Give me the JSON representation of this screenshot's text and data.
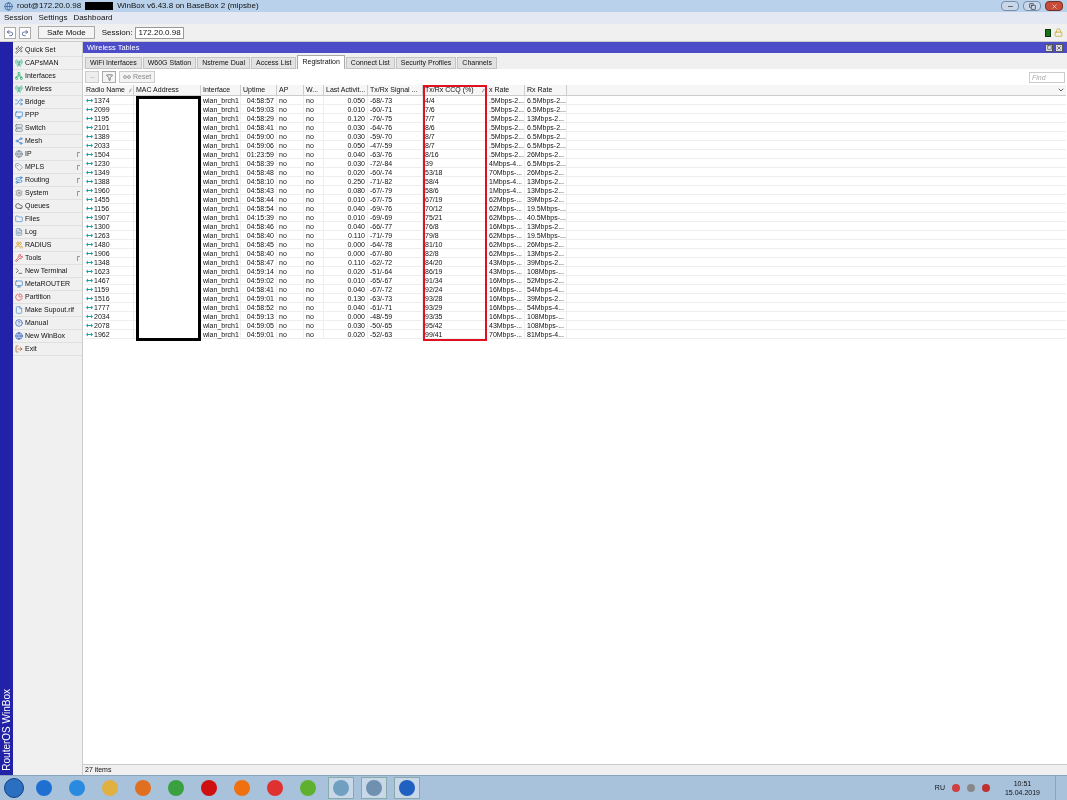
{
  "window": {
    "title_left": "root@172.20.0.98",
    "title_right": "WinBox v6.43.8 on BaseBox 2 (mipsbe)"
  },
  "menu": [
    "Session",
    "Settings",
    "Dashboard"
  ],
  "toolbar": {
    "safe_mode": "Safe Mode",
    "session_label": "Session:",
    "session_value": "172.20.0.98"
  },
  "sidebar": {
    "brand": "RouterOS WinBox",
    "items": [
      {
        "label": "Quick Set",
        "has_submenu": false
      },
      {
        "label": "CAPsMAN",
        "has_submenu": false
      },
      {
        "label": "Interfaces",
        "has_submenu": false
      },
      {
        "label": "Wireless",
        "has_submenu": false
      },
      {
        "label": "Bridge",
        "has_submenu": false
      },
      {
        "label": "PPP",
        "has_submenu": false
      },
      {
        "label": "Switch",
        "has_submenu": false
      },
      {
        "label": "Mesh",
        "has_submenu": false
      },
      {
        "label": "IP",
        "has_submenu": true
      },
      {
        "label": "MPLS",
        "has_submenu": true
      },
      {
        "label": "Routing",
        "has_submenu": true
      },
      {
        "label": "System",
        "has_submenu": true
      },
      {
        "label": "Queues",
        "has_submenu": false
      },
      {
        "label": "Files",
        "has_submenu": false
      },
      {
        "label": "Log",
        "has_submenu": false
      },
      {
        "label": "RADIUS",
        "has_submenu": false
      },
      {
        "label": "Tools",
        "has_submenu": true
      },
      {
        "label": "New Terminal",
        "has_submenu": false
      },
      {
        "label": "MetaROUTER",
        "has_submenu": false
      },
      {
        "label": "Partition",
        "has_submenu": false
      },
      {
        "label": "Make Supout.rif",
        "has_submenu": false
      },
      {
        "label": "Manual",
        "has_submenu": false
      },
      {
        "label": "New WinBox",
        "has_submenu": false
      },
      {
        "label": "Exit",
        "has_submenu": false
      }
    ]
  },
  "panel": {
    "title": "Wireless Tables",
    "tabs": [
      {
        "label": "WiFi Interfaces",
        "selected": false
      },
      {
        "label": "W60G Station",
        "selected": false
      },
      {
        "label": "Nstreme Dual",
        "selected": false
      },
      {
        "label": "Access List",
        "selected": false
      },
      {
        "label": "Registration",
        "selected": true
      },
      {
        "label": "Connect List",
        "selected": false
      },
      {
        "label": "Security Profiles",
        "selected": false
      },
      {
        "label": "Channels",
        "selected": false
      }
    ],
    "reset_label": "Reset",
    "find_placeholder": "Find",
    "columns": [
      {
        "label": "Radio Name",
        "sorted": true,
        "highlighted": false
      },
      {
        "label": "MAC Address",
        "sorted": false,
        "highlighted": false
      },
      {
        "label": "Interface",
        "sorted": false,
        "highlighted": false
      },
      {
        "label": "Uptime",
        "sorted": false,
        "highlighted": false
      },
      {
        "label": "AP",
        "sorted": false,
        "highlighted": false
      },
      {
        "label": "W...",
        "sorted": false,
        "highlighted": false
      },
      {
        "label": "Last Activit...",
        "sorted": false,
        "highlighted": false
      },
      {
        "label": "Tx/Rx Signal ...",
        "sorted": false,
        "highlighted": false
      },
      {
        "label": "Tx/Rx CCQ (%)",
        "sorted": true,
        "highlighted": true
      },
      {
        "label": "x Rate",
        "sorted": false,
        "highlighted": false
      },
      {
        "label": "Rx Rate",
        "sorted": false,
        "highlighted": false
      }
    ],
    "rows": [
      [
        "1374",
        "",
        "wlan_brch1",
        "04:58:57",
        "no",
        "no",
        "0.050",
        "-68/-73",
        "4/4",
        ".5Mbps-2...",
        "6.5Mbps-2..."
      ],
      [
        "2099",
        "",
        "wlan_brch1",
        "04:59:03",
        "no",
        "no",
        "0.010",
        "-60/-71",
        "7/6",
        ".5Mbps-2...",
        "6.5Mbps-2..."
      ],
      [
        "1195",
        "",
        "wlan_brch1",
        "04:58:29",
        "no",
        "no",
        "0.120",
        "-76/-75",
        "7/7",
        ".5Mbps-2...",
        "13Mbps-2..."
      ],
      [
        "2101",
        "",
        "wlan_brch1",
        "04:58:41",
        "no",
        "no",
        "0.030",
        "-64/-76",
        "8/6",
        ".5Mbps-2...",
        "6.5Mbps-2..."
      ],
      [
        "1389",
        "",
        "wlan_brch1",
        "04:59:00",
        "no",
        "no",
        "0.030",
        "-59/-70",
        "8/7",
        ".5Mbps-2...",
        "6.5Mbps-2..."
      ],
      [
        "2033",
        "",
        "wlan_brch1",
        "04:59:06",
        "no",
        "no",
        "0.050",
        "-47/-59",
        "8/7",
        ".5Mbps-2...",
        "6.5Mbps-2..."
      ],
      [
        "1504",
        "",
        "wlan_brch1",
        "01:23:59",
        "no",
        "no",
        "0.040",
        "-63/-76",
        "8/16",
        ".5Mbps-2...",
        "26Mbps-2..."
      ],
      [
        "1230",
        "",
        "wlan_brch1",
        "04:58:39",
        "no",
        "no",
        "0.030",
        "-72/-84",
        "39",
        "4Mbps-4...",
        "6.5Mbps-2..."
      ],
      [
        "1349",
        "",
        "wlan_brch1",
        "04:58:48",
        "no",
        "no",
        "0.020",
        "-60/-74",
        "53/18",
        "70Mbps-...",
        "26Mbps-2..."
      ],
      [
        "1388",
        "",
        "wlan_brch1",
        "04:58:10",
        "no",
        "no",
        "0.250",
        "-71/-82",
        "58/4",
        "1Mbps-4...",
        "13Mbps-2..."
      ],
      [
        "1960",
        "",
        "wlan_brch1",
        "04:58:43",
        "no",
        "no",
        "0.080",
        "-67/-79",
        "58/6",
        "1Mbps-4...",
        "13Mbps-2..."
      ],
      [
        "1455",
        "",
        "wlan_brch1",
        "04:58:44",
        "no",
        "no",
        "0.010",
        "-67/-75",
        "67/19",
        "62Mbps-...",
        "39Mbps-2..."
      ],
      [
        "1156",
        "",
        "wlan_brch1",
        "04:58:54",
        "no",
        "no",
        "0.040",
        "-69/-76",
        "70/12",
        "62Mbps-...",
        "19.5Mbps-..."
      ],
      [
        "1907",
        "",
        "wlan_brch1",
        "04:15:39",
        "no",
        "no",
        "0.010",
        "-69/-69",
        "75/21",
        "62Mbps-...",
        "40.5Mbps-..."
      ],
      [
        "1300",
        "",
        "wlan_brch1",
        "04:58:46",
        "no",
        "no",
        "0.040",
        "-66/-77",
        "76/8",
        "16Mbps-...",
        "13Mbps-2..."
      ],
      [
        "1263",
        "",
        "wlan_brch1",
        "04:58:40",
        "no",
        "no",
        "0.110",
        "-71/-79",
        "79/8",
        "62Mbps-...",
        "19.5Mbps-..."
      ],
      [
        "1480",
        "",
        "wlan_brch1",
        "04:58:45",
        "no",
        "no",
        "0.000",
        "-64/-78",
        "81/10",
        "62Mbps-...",
        "26Mbps-2..."
      ],
      [
        "1906",
        "",
        "wlan_brch1",
        "04:58:40",
        "no",
        "no",
        "0.000",
        "-67/-80",
        "82/8",
        "62Mbps-...",
        "13Mbps-2..."
      ],
      [
        "1348",
        "",
        "wlan_brch1",
        "04:58:47",
        "no",
        "no",
        "0.110",
        "-62/-72",
        "84/20",
        "43Mbps-...",
        "39Mbps-2..."
      ],
      [
        "1623",
        "",
        "wlan_brch1",
        "04:59:14",
        "no",
        "no",
        "0.020",
        "-51/-64",
        "86/19",
        "43Mbps-...",
        "108Mbps-..."
      ],
      [
        "1467",
        "",
        "wlan_brch1",
        "04:59:02",
        "no",
        "no",
        "0.010",
        "-65/-67",
        "91/34",
        "16Mbps-...",
        "52Mbps-2..."
      ],
      [
        "1159",
        "",
        "wlan_brch1",
        "04:58:41",
        "no",
        "no",
        "0.040",
        "-67/-72",
        "92/24",
        "16Mbps-...",
        "54Mbps-4..."
      ],
      [
        "1516",
        "",
        "wlan_brch1",
        "04:59:01",
        "no",
        "no",
        "0.130",
        "-63/-73",
        "93/28",
        "16Mbps-...",
        "39Mbps-2..."
      ],
      [
        "1777",
        "",
        "wlan_brch1",
        "04:58:52",
        "no",
        "no",
        "0.040",
        "-61/-71",
        "93/29",
        "16Mbps-...",
        "54Mbps-4..."
      ],
      [
        "2034",
        "",
        "wlan_brch1",
        "04:59:13",
        "no",
        "no",
        "0.000",
        "-48/-59",
        "93/35",
        "16Mbps-...",
        "108Mbps-..."
      ],
      [
        "2078",
        "",
        "wlan_brch1",
        "04:59:05",
        "no",
        "no",
        "0.030",
        "-50/-65",
        "95/42",
        "43Mbps-...",
        "108Mbps-..."
      ],
      [
        "1962",
        "",
        "wlan_brch1",
        "04:59:01",
        "no",
        "no",
        "0.020",
        "-52/-63",
        "99/41",
        "70Mbps-...",
        "81Mbps-4..."
      ]
    ],
    "status": "27 items"
  },
  "taskbar": {
    "language": "RU",
    "time": "10:51",
    "date": "15.04.2019"
  }
}
